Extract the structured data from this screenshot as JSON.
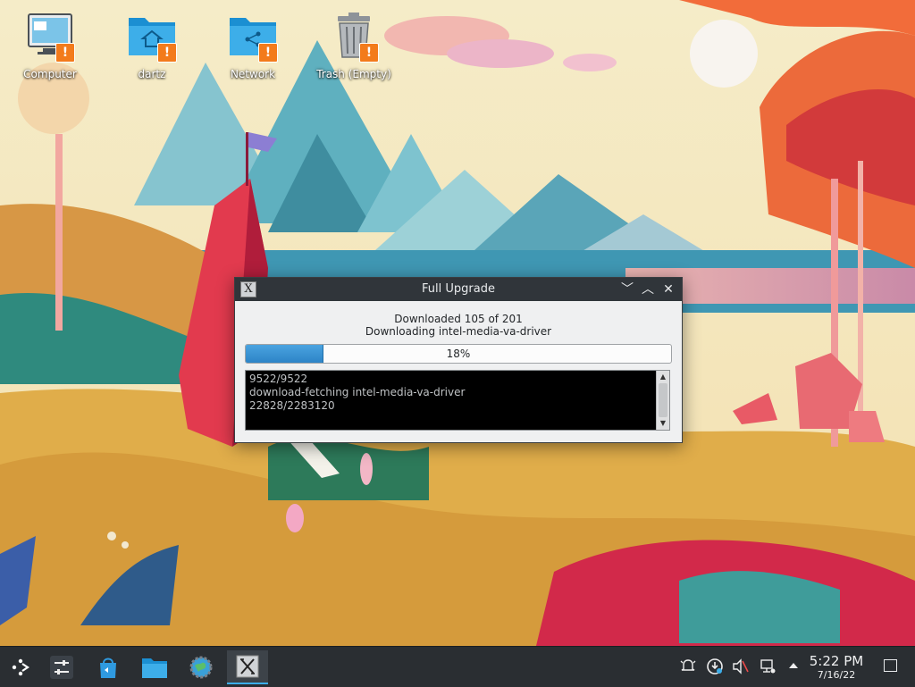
{
  "desktop": {
    "icons": [
      {
        "label": "Computer",
        "icon": "computer-icon"
      },
      {
        "label": "dartz",
        "icon": "home-folder-icon"
      },
      {
        "label": "Network",
        "icon": "network-folder-icon"
      },
      {
        "label": "Trash (Empty)",
        "icon": "trash-icon"
      }
    ],
    "warning_badge": "!"
  },
  "dialog": {
    "title": "Full Upgrade",
    "status_line1": "Downloaded 105 of 201",
    "status_line2": "Downloading intel-media-va-driver",
    "progress": {
      "percent_label": "18%",
      "value_fraction": 0.18,
      "fill_color": "#3a95d8"
    },
    "log_lines": [
      "9522/9522",
      "download-fetching intel-media-va-driver",
      "22828/2283120"
    ],
    "controls": {
      "minimize": "﹀",
      "maximize": "︿",
      "close": "✕"
    }
  },
  "taskbar": {
    "launchers": [
      {
        "name": "application-launcher-icon"
      },
      {
        "name": "system-settings-icon"
      },
      {
        "name": "discover-store-icon"
      },
      {
        "name": "file-manager-icon"
      },
      {
        "name": "web-browser-icon"
      },
      {
        "name": "upgrade-app-icon"
      }
    ],
    "tray": [
      "notifications-icon",
      "updates-icon",
      "volume-muted-icon",
      "network-icon",
      "expand-tray-icon"
    ],
    "clock": {
      "time": "5:22 PM",
      "date": "7/16/22"
    }
  }
}
